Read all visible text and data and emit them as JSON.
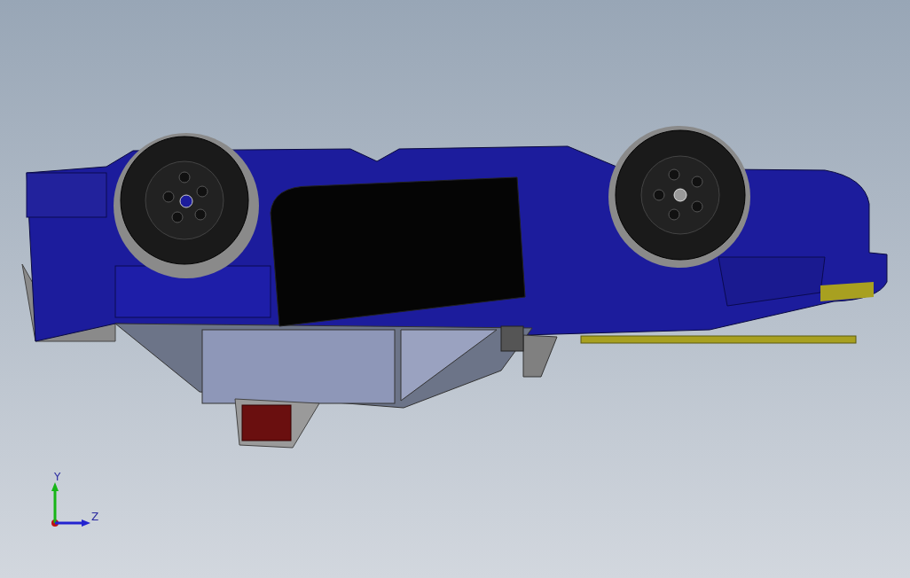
{
  "viewport": {
    "triad": {
      "axes": [
        {
          "label": "Y",
          "color": "#17b517"
        },
        {
          "label": "Z",
          "color": "#2323d0"
        }
      ]
    }
  }
}
